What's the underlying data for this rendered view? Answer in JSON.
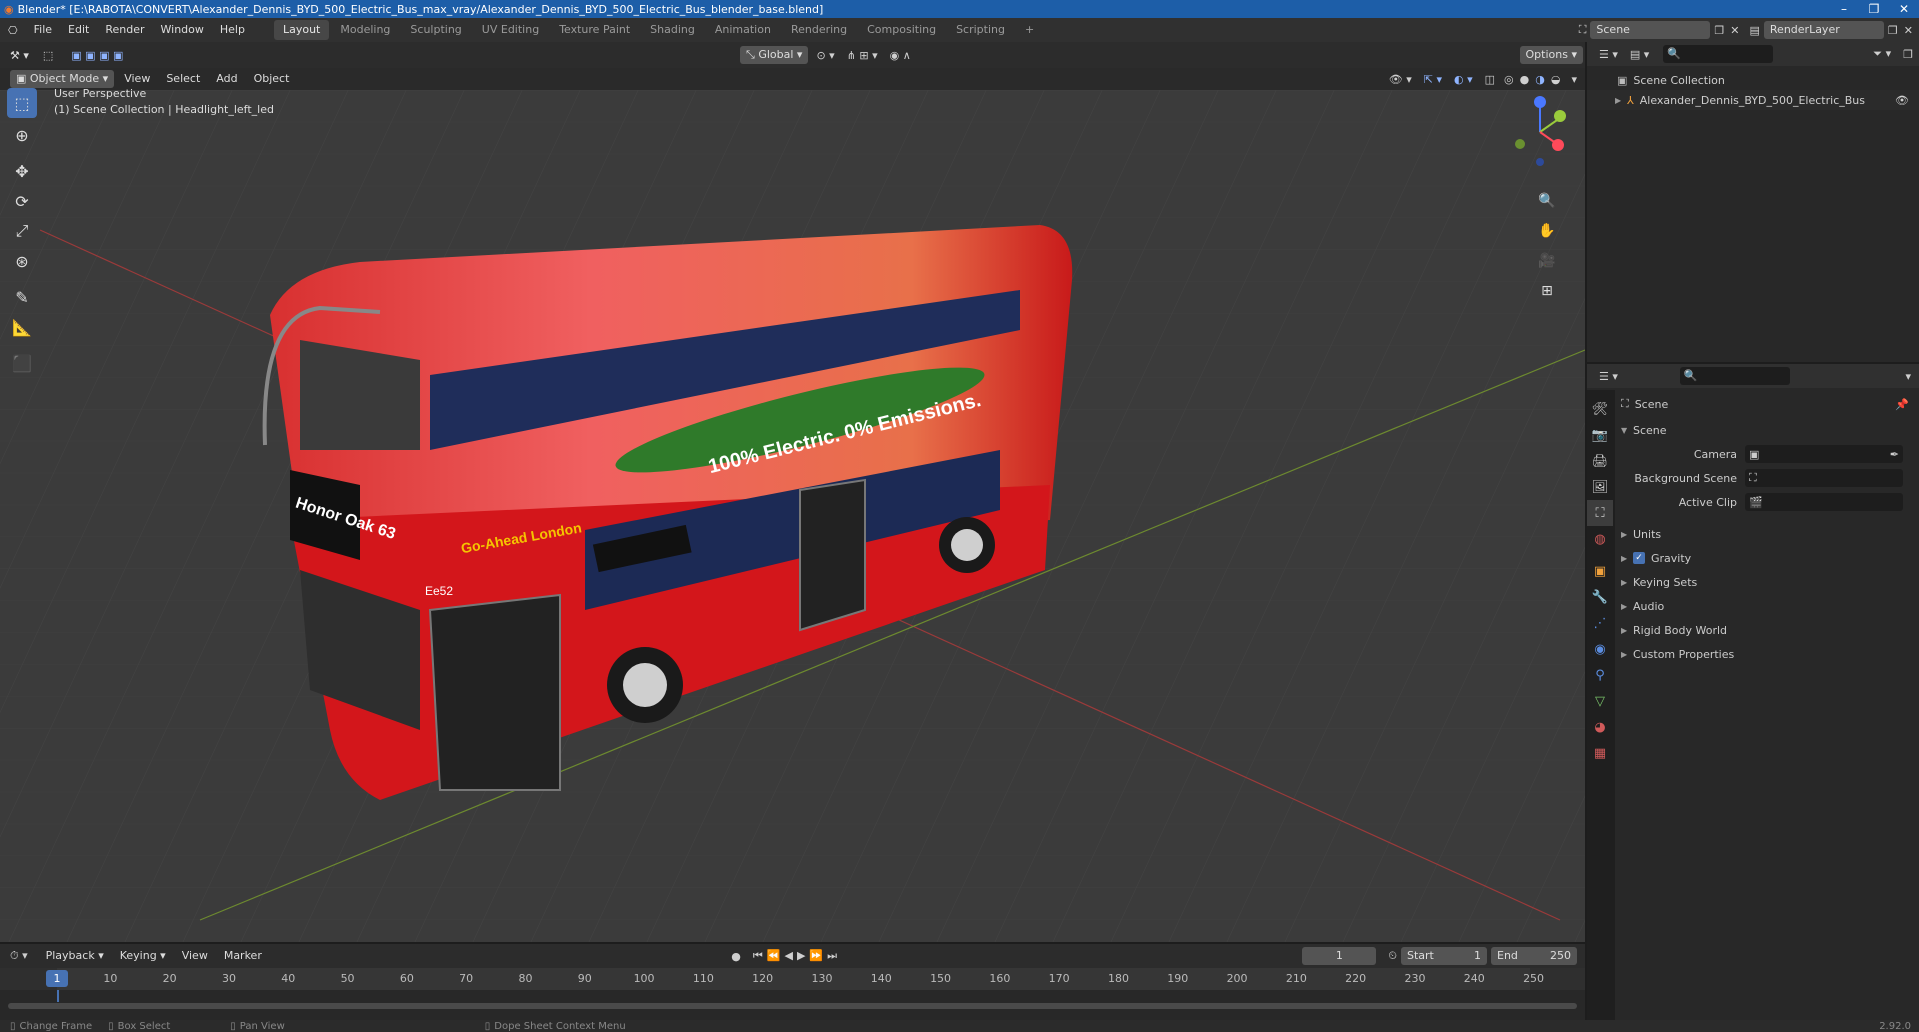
{
  "titlebar": {
    "title": "Blender* [E:\\RABOTA\\CONVERT\\Alexander_Dennis_BYD_500_Electric_Bus_max_vray/Alexander_Dennis_BYD_500_Electric_Bus_blender_base.blend]"
  },
  "menubar": {
    "menus": [
      "File",
      "Edit",
      "Render",
      "Window",
      "Help"
    ],
    "workspaces": [
      "Layout",
      "Modeling",
      "Sculpting",
      "UV Editing",
      "Texture Paint",
      "Shading",
      "Animation",
      "Rendering",
      "Compositing",
      "Scripting"
    ],
    "active_workspace": "Layout",
    "scene_name": "Scene",
    "view_layer": "RenderLayer"
  },
  "viewport": {
    "mode": "Object Mode",
    "menus": [
      "View",
      "Select",
      "Add",
      "Object"
    ],
    "orientation": "Global",
    "options_label": "Options",
    "perspective_label": "User Perspective",
    "collection_label": "(1) Scene Collection | Headlight_left_led"
  },
  "bus": {
    "destination": "Honor Oak 63",
    "destination_side": "Honor Oak 63",
    "fleet_number": "Ee52",
    "slogan": "100% Electric. 0% Emissions.",
    "operator": "Go-Ahead London"
  },
  "outliner": {
    "root": "Scene Collection",
    "items": [
      "Alexander_Dennis_BYD_500_Electric_Bus"
    ]
  },
  "properties": {
    "title": "Scene",
    "section": "Scene",
    "fields": [
      {
        "label": "Camera",
        "value": ""
      },
      {
        "label": "Background Scene",
        "value": ""
      },
      {
        "label": "Active Clip",
        "value": ""
      }
    ],
    "subsections": [
      "Units",
      "Gravity",
      "Keying Sets",
      "Audio",
      "Rigid Body World",
      "Custom Properties"
    ],
    "gravity_checked": true
  },
  "timeline": {
    "menus": [
      "Playback",
      "Keying",
      "View",
      "Marker"
    ],
    "current_frame": "1",
    "start_label": "Start",
    "start": "1",
    "end_label": "End",
    "end": "250",
    "ticks": [
      "1",
      "10",
      "20",
      "30",
      "40",
      "50",
      "60",
      "70",
      "80",
      "90",
      "100",
      "110",
      "120",
      "130",
      "140",
      "150",
      "160",
      "170",
      "180",
      "190",
      "200",
      "210",
      "220",
      "230",
      "240",
      "250"
    ]
  },
  "statusbar": {
    "items": [
      "Change Frame",
      "Box Select",
      "Pan View",
      "Dope Sheet Context Menu"
    ],
    "version": "2.92.0"
  }
}
